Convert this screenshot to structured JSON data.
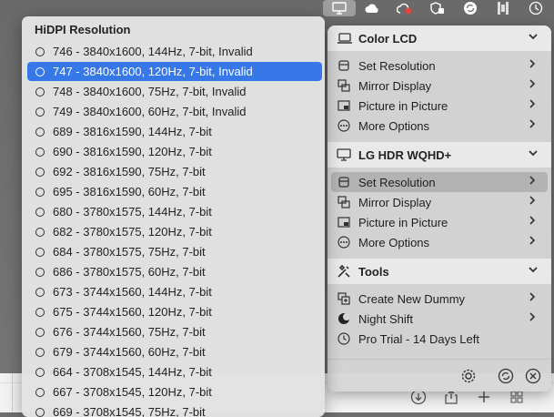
{
  "menubar": {
    "icons": [
      "display-menu-icon",
      "weather-cloud-icon",
      "betterdisplay-icon",
      "shield-lock-icon",
      "sync-icon",
      "grid-menu-icon",
      "clock-icon"
    ]
  },
  "popup": {
    "title": "HiDPI Resolution",
    "selected_index": 1,
    "options": [
      "746 - 3840x1600, 144Hz, 7-bit, Invalid",
      "747 - 3840x1600, 120Hz, 7-bit, Invalid",
      "748 - 3840x1600, 75Hz, 7-bit, Invalid",
      "749 - 3840x1600, 60Hz, 7-bit, Invalid",
      "689 - 3816x1590, 144Hz, 7-bit",
      "690 - 3816x1590, 120Hz, 7-bit",
      "692 - 3816x1590, 75Hz, 7-bit",
      "695 - 3816x1590, 60Hz, 7-bit",
      "680 - 3780x1575, 144Hz, 7-bit",
      "682 - 3780x1575, 120Hz, 7-bit",
      "684 - 3780x1575, 75Hz, 7-bit",
      "686 - 3780x1575, 60Hz, 7-bit",
      "673 - 3744x1560, 144Hz, 7-bit",
      "675 - 3744x1560, 120Hz, 7-bit",
      "676 - 3744x1560, 75Hz, 7-bit",
      "679 - 3744x1560, 60Hz, 7-bit",
      "664 - 3708x1545, 144Hz, 7-bit",
      "667 - 3708x1545, 120Hz, 7-bit",
      "669 - 3708x1545, 75Hz, 7-bit"
    ]
  },
  "panel": {
    "display1": {
      "name": "Color LCD",
      "items": [
        "Set Resolution",
        "Mirror Display",
        "Picture in Picture",
        "More Options"
      ]
    },
    "display2": {
      "name": "LG HDR WQHD+",
      "items": [
        "Set Resolution",
        "Mirror Display",
        "Picture in Picture",
        "More Options"
      ]
    },
    "tools": {
      "name": "Tools",
      "items": [
        "Create New Dummy",
        "Night Shift",
        "Pro Trial - 14 Days Left"
      ]
    },
    "footer_icons": [
      "settings-gear-icon",
      "refresh-icon",
      "close-icon"
    ]
  },
  "colors": {
    "selection": "#3778e8",
    "panel_bg": "#d6d6d6",
    "popup_bg": "#e2e2e2"
  }
}
